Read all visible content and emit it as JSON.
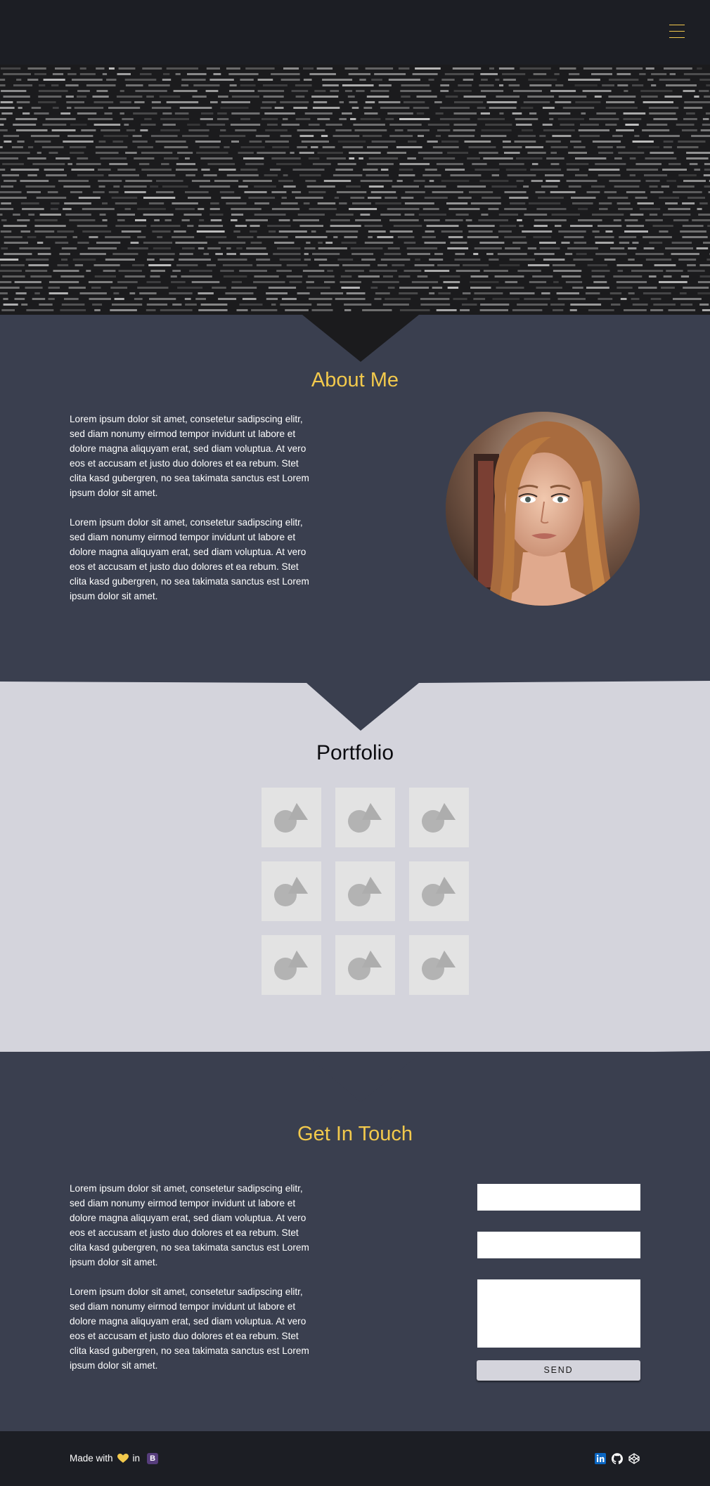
{
  "nav": {
    "menu_icon": "hamburger-icon"
  },
  "about": {
    "title": "About Me",
    "paragraphs": [
      "Lorem ipsum dolor sit amet, consetetur sadipscing elitr, sed diam nonumy eirmod tempor invidunt ut labore et dolore magna aliquyam erat, sed diam voluptua. At vero eos et accusam et justo duo dolores et ea rebum. Stet clita kasd gubergren, no sea takimata sanctus est Lorem ipsum dolor sit amet.",
      "Lorem ipsum dolor sit amet, consetetur sadipscing elitr, sed diam nonumy eirmod tempor invidunt ut labore et dolore magna aliquyam erat, sed diam voluptua. At vero eos et accusam et justo duo dolores et ea rebum. Stet clita kasd gubergren, no sea takimata sanctus est Lorem ipsum dolor sit amet."
    ]
  },
  "portfolio": {
    "title": "Portfolio",
    "tiles": [
      "image-placeholder-icon",
      "image-placeholder-icon",
      "image-placeholder-icon",
      "image-placeholder-icon",
      "image-placeholder-icon",
      "image-placeholder-icon",
      "image-placeholder-icon",
      "image-placeholder-icon",
      "image-placeholder-icon"
    ]
  },
  "contact": {
    "title": "Get In Touch",
    "paragraphs": [
      "Lorem ipsum dolor sit amet, consetetur sadipscing elitr, sed diam nonumy eirmod tempor invidunt ut labore et dolore magna aliquyam erat, sed diam voluptua. At vero eos et accusam et justo duo dolores et ea rebum. Stet clita kasd gubergren, no sea takimata sanctus est Lorem ipsum dolor sit amet.",
      "Lorem ipsum dolor sit amet, consetetur sadipscing elitr, sed diam nonumy eirmod tempor invidunt ut labore et dolore magna aliquyam erat, sed diam voluptua. At vero eos et accusam et justo duo dolores et ea rebum. Stet clita kasd gubergren, no sea takimata sanctus est Lorem ipsum dolor sit amet."
    ],
    "send_label": "SEND"
  },
  "footer": {
    "made_with": "Made with",
    "heart_icon": "heart-icon",
    "in_text": "in",
    "bootstrap_badge": "B",
    "socials": [
      "linkedin-icon",
      "github-icon",
      "codepen-icon"
    ]
  },
  "colors": {
    "accent": "#f2c94c",
    "dark_section": "#3a3f4f",
    "light_section": "#d4d4dc",
    "navbar": "#1c1e24"
  }
}
